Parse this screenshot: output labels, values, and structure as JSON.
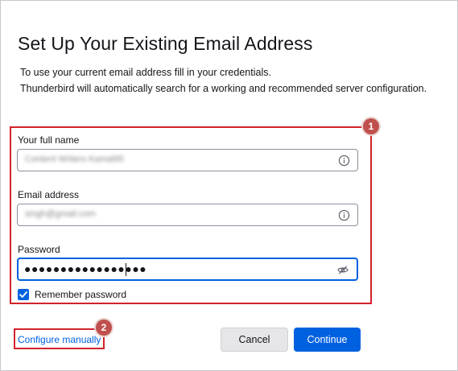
{
  "page": {
    "title": "Set Up Your Existing Email Address",
    "description_line1": "To use your current email address fill in your credentials.",
    "description_line2": "Thunderbird will automatically search for a working and recommended server configuration."
  },
  "form": {
    "full_name": {
      "label": "Your full name",
      "value": "Content Writers Kamal95"
    },
    "email": {
      "label": "Email address",
      "value": "singh@gmail.com"
    },
    "password": {
      "label": "Password",
      "value": "●●●●●●●●●●●●●●●●●"
    },
    "remember": {
      "label": "Remember password",
      "checked": true
    }
  },
  "actions": {
    "configure_manually": "Configure manually",
    "cancel": "Cancel",
    "continue": "Continue"
  },
  "annotations": {
    "badge1": "1",
    "badge2": "2"
  },
  "colors": {
    "accent": "#0061e0",
    "annotation": "#d2232a",
    "badge": "#c0504d"
  }
}
